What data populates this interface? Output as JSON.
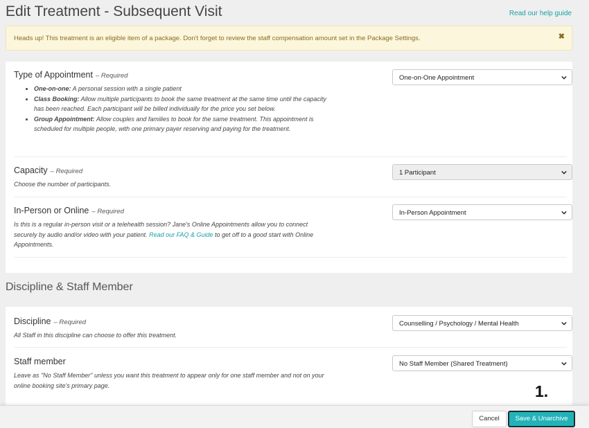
{
  "page": {
    "title": "Edit Treatment - Subsequent Visit",
    "help_link": "Read our help guide"
  },
  "alert": {
    "text": "Heads up! This treatment is an eligible item of a package. Don't forget to review the staff compensation amount set in the Package Settings.",
    "close_icon": "close-icon",
    "close_glyph": "✖"
  },
  "appointment": {
    "type": {
      "title": "Type of Appointment",
      "required": "– Required",
      "options": [
        {
          "term": "One-on-one:",
          "text": " A personal session with a single patient"
        },
        {
          "term": "Class Booking:",
          "text": " Allow multiple participants to book the same treatment at the same time until the capacity has been reached. Each participant will be billed individually for the price you set below."
        },
        {
          "term": "Group Appointment:",
          "text": " Allow couples and families to book for the same treatment. This appointment is scheduled for multiple people, with one primary payer reserving and paying for the treatment."
        }
      ],
      "selected": "One-on-One Appointment"
    },
    "capacity": {
      "title": "Capacity",
      "required": "– Required",
      "desc": "Choose the number of participants.",
      "selected": "1 Participant"
    },
    "mode": {
      "title": "In-Person or Online",
      "required": "– Required",
      "desc_before": "Is this is a regular in-person visit or a telehealth session? Jane's Online Appointments allow you to connect securely by audio and/or video with your patient. ",
      "desc_link": "Read our FAQ & Guide",
      "desc_after": " to get off to a good start with Online Appointments.",
      "selected": "In-Person Appointment"
    }
  },
  "discipline_section": {
    "title": "Discipline & Staff Member",
    "discipline": {
      "title": "Discipline",
      "required": "– Required",
      "desc": "All Staff in this discipline can choose to offer this treatment.",
      "selected": "Counselling / Psychology / Mental Health"
    },
    "staff": {
      "title": "Staff member",
      "desc": "Leave as \"No Staff Member\" unless you want this treatment to appear only for one staff member and not on your online booking site's primary page.",
      "selected": "No Staff Member (Shared Treatment)"
    }
  },
  "footer": {
    "cancel_label": "Cancel",
    "save_label": "Save & Unarchive",
    "step_label": "1."
  },
  "colors": {
    "accent": "#22b3b9",
    "link": "#1a9fa5",
    "alert_bg": "#fcf6dd",
    "alert_text": "#8a6d1f"
  }
}
